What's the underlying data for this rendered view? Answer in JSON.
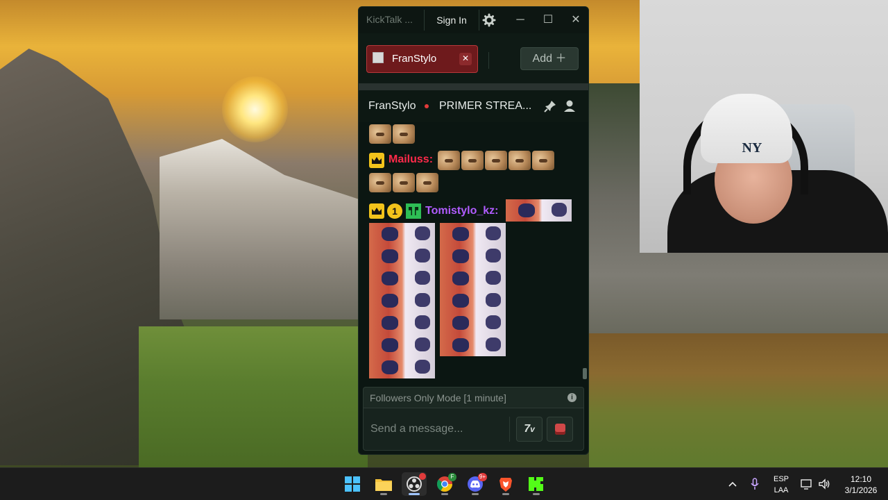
{
  "window": {
    "title": "KickTalk ...",
    "signin_label": "Sign In",
    "minimize": "─",
    "maximize": "☐",
    "close": "✕"
  },
  "tabs": [
    {
      "label": "FranStylo",
      "close": "✕"
    }
  ],
  "add_button": {
    "label": "Add ＋"
  },
  "channel": {
    "name": "FranStylo",
    "title": "PRIMER STREA...",
    "live_color": "#e23a3a"
  },
  "messages": [
    {
      "username": "",
      "emote_count": 2
    },
    {
      "username": "Mailuss:",
      "color": "#ff2a4a",
      "badges": [
        "crown-icon"
      ],
      "emote_count": 8
    },
    {
      "username": "Tomistylo_kz:",
      "color": "#b15cff",
      "badges": [
        "crown-icon",
        "tier-badge",
        "creeper-icon"
      ],
      "badge_number": "1",
      "gif_count": 14
    }
  ],
  "composer": {
    "followers_notice": "Followers Only Mode [1 minute]",
    "placeholder": "Send a message...",
    "emote_7tv_label": "7TV"
  },
  "taskbar": {
    "apps": [
      {
        "name": "start-button",
        "icon": "windows-icon"
      },
      {
        "name": "file-explorer",
        "icon": "folder-icon"
      },
      {
        "name": "obs",
        "icon": "obs-icon",
        "active": true
      },
      {
        "name": "chrome",
        "icon": "chrome-icon"
      },
      {
        "name": "discord",
        "icon": "discord-icon",
        "badge": "9+"
      },
      {
        "name": "brave",
        "icon": "brave-icon"
      },
      {
        "name": "kick",
        "icon": "kick-icon"
      }
    ],
    "lang_top": "ESP",
    "lang_bottom": "LAA",
    "time": "12:10",
    "date": "3/1/2026"
  },
  "colors": {
    "accent_tab": "#6e1a1c",
    "window_bg": "#0b1612",
    "kick_green": "#53fc18"
  }
}
